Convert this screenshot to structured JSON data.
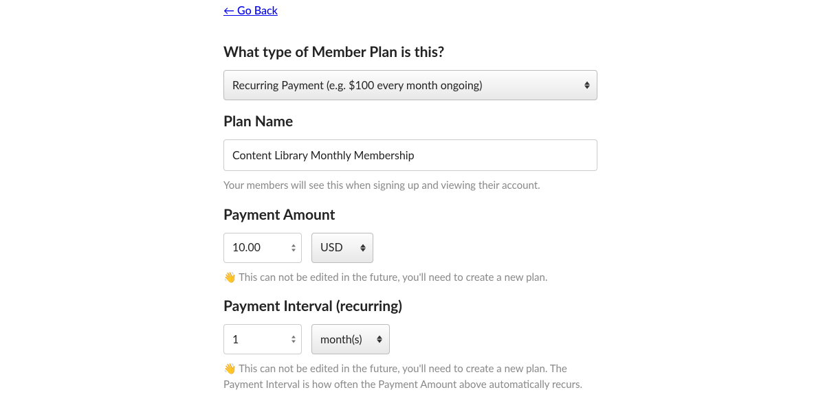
{
  "goBack": "← Go Back",
  "planType": {
    "label": "What type of Member Plan is this?",
    "value": "Recurring Payment (e.g. $100 every month ongoing)"
  },
  "planName": {
    "label": "Plan Name",
    "value": "Content Library Monthly Membership",
    "helper": "Your members will see this when signing up and viewing their account."
  },
  "paymentAmount": {
    "label": "Payment Amount",
    "value": "10.00",
    "currency": "USD",
    "helper": "👋 This can not be edited in the future, you'll need to create a new plan."
  },
  "paymentInterval": {
    "label": "Payment Interval (recurring)",
    "value": "1",
    "unit": "month(s)",
    "helper": "👋 This can not be edited in the future, you'll need to create a new plan. The Payment Interval is how often the Payment Amount above automatically recurs."
  }
}
